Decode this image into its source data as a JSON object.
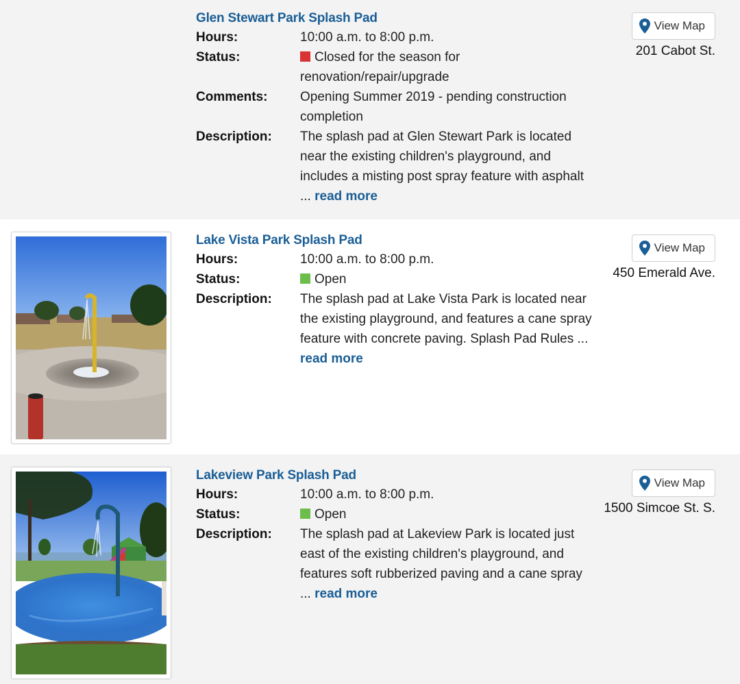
{
  "listings": [
    {
      "title": "Glen Stewart Park Splash Pad",
      "hours_label": "Hours:",
      "hours": "10:00 a.m. to 8:00 p.m.",
      "status_label": "Status:",
      "status": "Closed for the season for renovation/repair/upgrade",
      "status_color": "#c91a1a",
      "comments_label": "Comments:",
      "comments": "Opening Summer 2019 - pending construction completion",
      "description_label": "Description:",
      "description": "The splash pad at Glen Stewart Park is located near the existing children's playground, and includes a misting post spray feature with asphalt ...",
      "read_more": "read more",
      "map_button": "View Map",
      "address": "201 Cabot St."
    },
    {
      "title": "Lake Vista Park Splash Pad",
      "hours_label": "Hours:",
      "hours": "10:00 a.m. to 8:00 p.m.",
      "status_label": "Status:",
      "status": "Open",
      "status_color": "#3c8a2e",
      "description_label": "Description:",
      "description": "The splash pad at Lake Vista Park is located near the existing playground, and features a cane spray feature with concrete paving. Splash Pad Rules ...",
      "read_more": "read more",
      "map_button": "View Map",
      "address": "450 Emerald Ave."
    },
    {
      "title": "Lakeview Park Splash Pad",
      "hours_label": "Hours:",
      "hours": "10:00 a.m. to 8:00 p.m.",
      "status_label": "Status:",
      "status": "Open",
      "status_color": "#3c8a2e",
      "description_label": "Description:",
      "description": "The splash pad at Lakeview Park is located just east of the existing children's playground, and features soft rubberized paving and a cane spray ...",
      "read_more": "read more",
      "map_button": "View Map",
      "address": "1500 Simcoe St. S."
    }
  ],
  "colors": {
    "link": "#1a5e96",
    "closed_swatch": "#d93434",
    "open_swatch": "#6cbd4c",
    "shaded_row": "#f3f3f3"
  },
  "icons": {
    "map_button": "map-pin-icon",
    "closed_status": "red-square-icon",
    "open_status": "green-square-icon"
  }
}
